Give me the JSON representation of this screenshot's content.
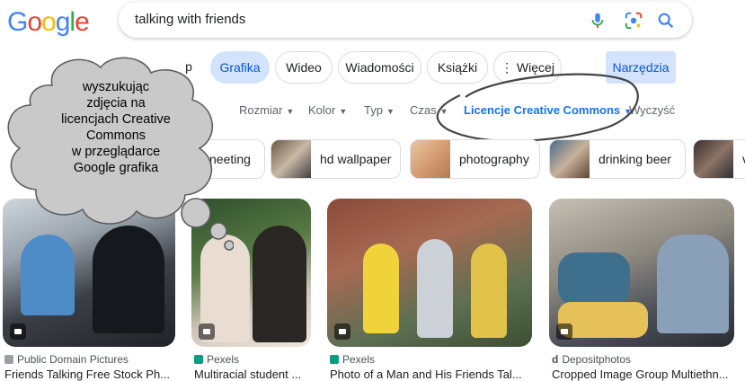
{
  "logo": {
    "text": "Google",
    "letters": [
      "G",
      "o",
      "o",
      "g",
      "l",
      "e"
    ]
  },
  "search": {
    "query": "talking with friends"
  },
  "tabs": [
    {
      "label": "p"
    },
    {
      "label": "Grafika"
    },
    {
      "label": "Wideo"
    },
    {
      "label": "Wiadomości"
    },
    {
      "label": "Książki"
    },
    {
      "label": "⋮ Więcej"
    },
    {
      "label": "Narzędzia"
    }
  ],
  "filters": [
    {
      "label": "Rozmiar"
    },
    {
      "label": "Kolor"
    },
    {
      "label": "Typ"
    },
    {
      "label": "Czas"
    },
    {
      "label": "Licencje Creative Commons"
    },
    {
      "label": "Wyczyść"
    }
  ],
  "chips": [
    {
      "label": "neeting"
    },
    {
      "label": "hd wallpaper"
    },
    {
      "label": "photography"
    },
    {
      "label": "drinking beer"
    },
    {
      "label": "v"
    }
  ],
  "results": [
    {
      "source": "Public Domain Pictures",
      "title": "Friends Talking Free Stock Ph..."
    },
    {
      "source": "Pexels",
      "title": "Multiracial student ..."
    },
    {
      "source": "Pexels",
      "title": "Photo of a Man and His Friends Tal..."
    },
    {
      "source": "Depositphotos",
      "title": "Cropped Image Group Multiethn..."
    }
  ],
  "callout": {
    "lines": [
      "wyszukując",
      "zdjęcia na",
      "licencjach Creative",
      "Commons",
      "w przeglądarce",
      "Google grafika"
    ]
  },
  "colors": {
    "accent": "#1a73e8",
    "active_tab_bg": "#d3e3fd",
    "g_blue": "#4285f4",
    "g_red": "#ea4335",
    "g_yellow": "#fbbc05",
    "g_green": "#34a853"
  }
}
